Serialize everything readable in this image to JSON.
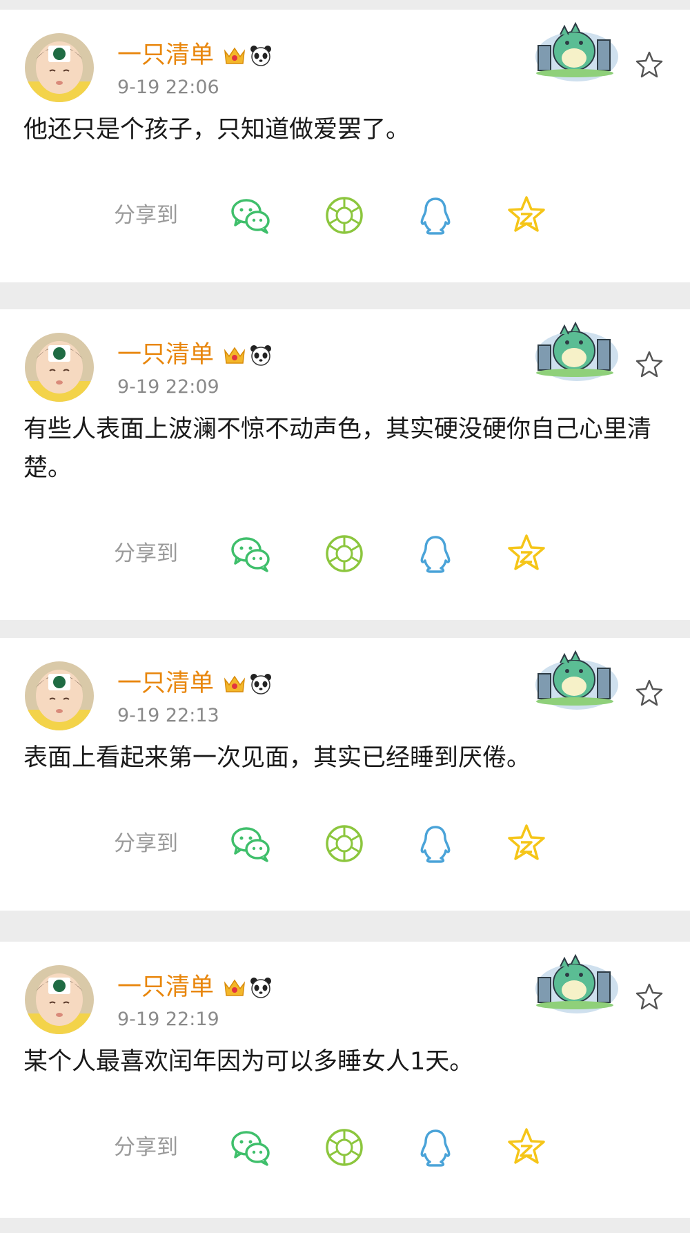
{
  "share_label": "分享到",
  "share_targets": [
    "wechat-icon",
    "moments-icon",
    "qq-icon",
    "qzone-icon"
  ],
  "posts": [
    {
      "username": "一只清单",
      "timestamp": "9-19 22:06",
      "text": "他还只是个孩子，只知道做爱罢了。"
    },
    {
      "username": "一只清单",
      "timestamp": "9-19 22:09",
      "text": "有些人表面上波澜不惊不动声色，其实硬没硬你自己心里清楚。"
    },
    {
      "username": "一只清单",
      "timestamp": "9-19 22:13",
      "text": "表面上看起来第一次见面，其实已经睡到厌倦。"
    },
    {
      "username": "一只清单",
      "timestamp": "9-19 22:19",
      "text": "某个人最喜欢闰年因为可以多睡女人1天。"
    }
  ],
  "colors": {
    "username": "#e8860c",
    "timestamp": "#8a8a8a",
    "wechat": "#3fbf6b",
    "moments": "#8cc63e",
    "qq": "#4aa3d8",
    "qzone": "#f5c518",
    "separator": "#ececec"
  }
}
